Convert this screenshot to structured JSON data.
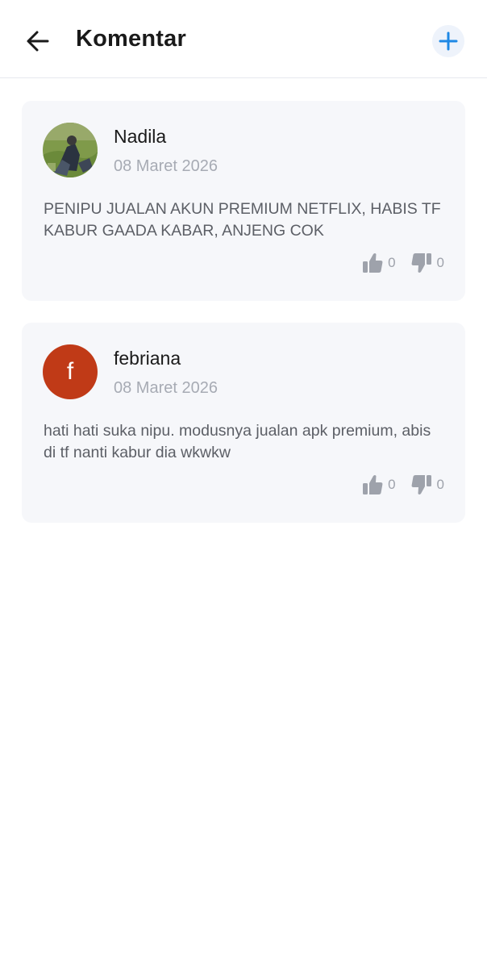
{
  "header": {
    "title": "Komentar",
    "back_icon": "arrow-left-icon",
    "add_icon": "plus-icon",
    "accent_color": "#1e88e5"
  },
  "comments": [
    {
      "author": "Nadila",
      "date": "08 Maret 2026",
      "avatar_type": "photo",
      "text": "PENIPU JUALAN AKUN PREMIUM NETFLIX, HABIS TF KABUR GAADA KABAR, ANJENG COK",
      "likes": "0",
      "dislikes": "0"
    },
    {
      "author": "febriana",
      "date": "08 Maret 2026",
      "avatar_type": "letter",
      "avatar_letter": "f",
      "avatar_color": "#c03a17",
      "text": "hati hati suka nipu. modusnya jualan apk premium, abis di tf nanti kabur dia wkwkw",
      "likes": "0",
      "dislikes": "0"
    }
  ]
}
